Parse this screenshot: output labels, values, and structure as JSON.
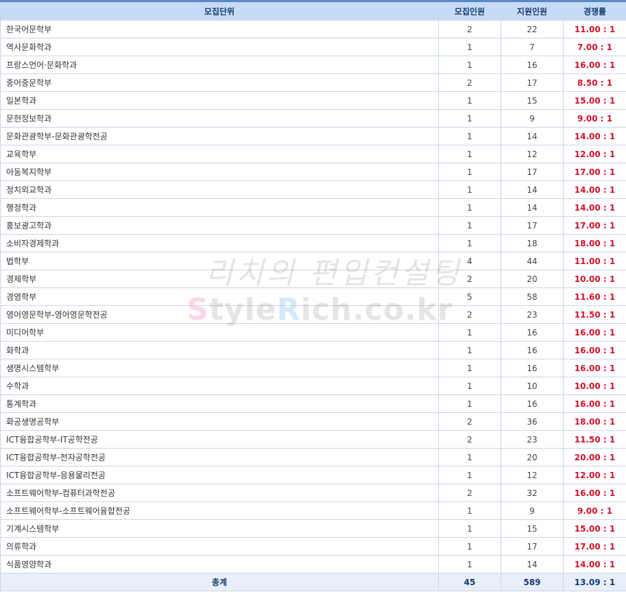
{
  "header": {
    "unit": "모집단위",
    "quota": "모집인원",
    "applicants": "지원인원",
    "ratio": "경쟁률"
  },
  "rows": [
    {
      "name": "한국어문학부",
      "quota": "2",
      "applicants": "22",
      "ratio": "11.00 : 1"
    },
    {
      "name": "역사문화학과",
      "quota": "1",
      "applicants": "7",
      "ratio": "7.00 : 1"
    },
    {
      "name": "프랑스언어·문화학과",
      "quota": "1",
      "applicants": "16",
      "ratio": "16.00 : 1"
    },
    {
      "name": "중어중문학부",
      "quota": "2",
      "applicants": "17",
      "ratio": "8.50 : 1"
    },
    {
      "name": "일본학과",
      "quota": "1",
      "applicants": "15",
      "ratio": "15.00 : 1"
    },
    {
      "name": "문헌정보학과",
      "quota": "1",
      "applicants": "9",
      "ratio": "9.00 : 1"
    },
    {
      "name": "문화관광학부-문화관광학전공",
      "quota": "1",
      "applicants": "14",
      "ratio": "14.00 : 1"
    },
    {
      "name": "교육학부",
      "quota": "1",
      "applicants": "12",
      "ratio": "12.00 : 1"
    },
    {
      "name": "아동복지학부",
      "quota": "1",
      "applicants": "17",
      "ratio": "17.00 : 1"
    },
    {
      "name": "정치외교학과",
      "quota": "1",
      "applicants": "14",
      "ratio": "14.00 : 1"
    },
    {
      "name": "행정학과",
      "quota": "1",
      "applicants": "14",
      "ratio": "14.00 : 1"
    },
    {
      "name": "홍보광고학과",
      "quota": "1",
      "applicants": "17",
      "ratio": "17.00 : 1"
    },
    {
      "name": "소비자경제학과",
      "quota": "1",
      "applicants": "18",
      "ratio": "18.00 : 1"
    },
    {
      "name": "법학부",
      "quota": "4",
      "applicants": "44",
      "ratio": "11.00 : 1"
    },
    {
      "name": "경제학부",
      "quota": "2",
      "applicants": "20",
      "ratio": "10.00 : 1"
    },
    {
      "name": "경영학부",
      "quota": "5",
      "applicants": "58",
      "ratio": "11.60 : 1"
    },
    {
      "name": "영어영문학부-영어영문학전공",
      "quota": "2",
      "applicants": "23",
      "ratio": "11.50 : 1"
    },
    {
      "name": "미디어학부",
      "quota": "1",
      "applicants": "16",
      "ratio": "16.00 : 1"
    },
    {
      "name": "화학과",
      "quota": "1",
      "applicants": "16",
      "ratio": "16.00 : 1"
    },
    {
      "name": "생명시스템학부",
      "quota": "1",
      "applicants": "16",
      "ratio": "16.00 : 1"
    },
    {
      "name": "수학과",
      "quota": "1",
      "applicants": "10",
      "ratio": "10.00 : 1"
    },
    {
      "name": "통계학과",
      "quota": "1",
      "applicants": "16",
      "ratio": "16.00 : 1"
    },
    {
      "name": "화공생명공학부",
      "quota": "2",
      "applicants": "36",
      "ratio": "18.00 : 1"
    },
    {
      "name": "ICT융합공학부-IT공학전공",
      "quota": "2",
      "applicants": "23",
      "ratio": "11.50 : 1"
    },
    {
      "name": "ICT융합공학부-전자공학전공",
      "quota": "1",
      "applicants": "20",
      "ratio": "20.00 : 1"
    },
    {
      "name": "ICT융합공학부-응용물리전공",
      "quota": "1",
      "applicants": "12",
      "ratio": "12.00 : 1"
    },
    {
      "name": "소프트웨어학부-컴퓨터과학전공",
      "quota": "2",
      "applicants": "32",
      "ratio": "16.00 : 1"
    },
    {
      "name": "소프트웨어학부-소프트웨어융합전공",
      "quota": "1",
      "applicants": "9",
      "ratio": "9.00 : 1"
    },
    {
      "name": "기계시스템학부",
      "quota": "1",
      "applicants": "15",
      "ratio": "15.00 : 1"
    },
    {
      "name": "의류학과",
      "quota": "1",
      "applicants": "17",
      "ratio": "17.00 : 1"
    },
    {
      "name": "식품영양학과",
      "quota": "1",
      "applicants": "14",
      "ratio": "14.00 : 1"
    }
  ],
  "total": {
    "label": "총계",
    "quota": "45",
    "applicants": "589",
    "ratio": "13.09 : 1"
  },
  "watermark": {
    "korean": "리치의 편입컨설팅",
    "english_parts": [
      "S",
      "tyle",
      "R",
      "ich.co.kr"
    ]
  },
  "colors": {
    "header_bg": "#c6dcf6",
    "ratio_red": "#d0112b",
    "border": "#c7d6ea",
    "top_rule": "#5a88c6"
  }
}
